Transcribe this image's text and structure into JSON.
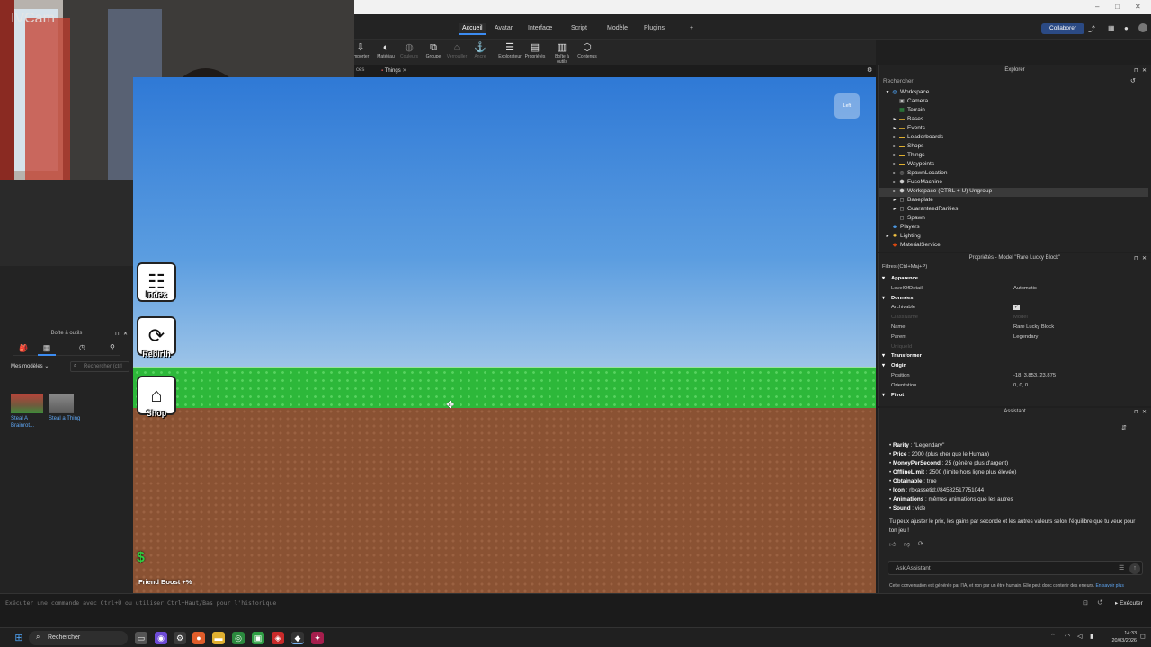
{
  "window": {
    "controls": [
      "–",
      "□",
      "✕"
    ]
  },
  "menu": {
    "tabs": [
      "Accueil",
      "Avatar",
      "Interface",
      "Script",
      "Modèle",
      "Plugins",
      "+"
    ],
    "active_tab": "Accueil",
    "collaborate": "Collaborer"
  },
  "toolbar": {
    "items": [
      {
        "label": "Importer",
        "icon": "import-icon"
      },
      {
        "label": "Matériau",
        "icon": "material-icon"
      },
      {
        "label": "Couleurs",
        "icon": "color-icon",
        "dim": true
      },
      {
        "label": "Groupe",
        "icon": "group-icon"
      },
      {
        "label": "Verrouiller",
        "icon": "lock-icon",
        "dim": true
      },
      {
        "label": "Ancre",
        "icon": "anchor-icon",
        "dim": true
      },
      {
        "label": "Explorateur",
        "icon": "explorer-icon"
      },
      {
        "label": "Propriétés",
        "icon": "properties-icon"
      },
      {
        "label": "Boîte à outils",
        "icon": "toolbox-icon"
      },
      {
        "label": "Contenus",
        "icon": "content-icon"
      }
    ]
  },
  "doc_tabs": {
    "partial": "ces",
    "active": "Things"
  },
  "webcam": {
    "overlay": "IVCam"
  },
  "toolbox": {
    "title": "Boîte à outils",
    "category": "Mes modèles",
    "search_placeholder": "Rechercher (ctrl",
    "items": [
      {
        "label": "Steal A Brainrot..."
      },
      {
        "label": "Steal a Thing"
      }
    ]
  },
  "game_ui": {
    "buttons": [
      {
        "label": "Index",
        "icon": "index-icon"
      },
      {
        "label": "Rebirth",
        "icon": "rebirth-icon"
      },
      {
        "label": "Shop",
        "icon": "shop-icon"
      }
    ],
    "friend_boost": "Friend Boost +%",
    "currency_symbol": "$",
    "corner_label": "Left"
  },
  "explorer": {
    "title": "Explorer",
    "search_placeholder": "Rechercher",
    "items": [
      {
        "label": "Workspace",
        "depth": 0,
        "icon": "workspace-icon",
        "expanded": true
      },
      {
        "label": "Camera",
        "depth": 1,
        "icon": "camera-icon"
      },
      {
        "label": "Terrain",
        "depth": 1,
        "icon": "terrain-icon"
      },
      {
        "label": "Bases",
        "depth": 1,
        "icon": "folder-icon",
        "arrow": true
      },
      {
        "label": "Events",
        "depth": 1,
        "icon": "folder-icon",
        "arrow": true
      },
      {
        "label": "Leaderboards",
        "depth": 1,
        "icon": "folder-icon",
        "arrow": true
      },
      {
        "label": "Shops",
        "depth": 1,
        "icon": "folder-icon",
        "arrow": true
      },
      {
        "label": "Things",
        "depth": 1,
        "icon": "folder-icon",
        "arrow": true
      },
      {
        "label": "Waypoints",
        "depth": 1,
        "icon": "folder-icon",
        "arrow": true
      },
      {
        "label": "SpawnLocation",
        "depth": 1,
        "icon": "spawn-icon",
        "arrow": true
      },
      {
        "label": "FuseMachine",
        "depth": 1,
        "icon": "model-icon",
        "arrow": true
      },
      {
        "label": "Workspace (CTRL + U) Ungroup",
        "depth": 1,
        "icon": "model-icon",
        "arrow": true,
        "selected": true
      },
      {
        "label": "Baseplate",
        "depth": 1,
        "icon": "part-icon",
        "arrow": true
      },
      {
        "label": "GuaranteedRarities",
        "depth": 1,
        "icon": "part-icon",
        "arrow": true
      },
      {
        "label": "Spawn",
        "depth": 1,
        "icon": "part-icon"
      },
      {
        "label": "Players",
        "depth": 0,
        "icon": "players-icon"
      },
      {
        "label": "Lighting",
        "depth": 0,
        "icon": "lighting-icon",
        "arrow": true
      },
      {
        "label": "MaterialService",
        "depth": 0,
        "icon": "material-service-icon"
      }
    ]
  },
  "properties": {
    "title": "Propriétés - Model \"Rare Lucky Block\"",
    "filter": "Filtres (Ctrl+Maj+P)",
    "rows": [
      {
        "section": "Apparence"
      },
      {
        "key": "LevelOfDetail",
        "value": "Automatic"
      },
      {
        "section": "Données"
      },
      {
        "key": "Archivable",
        "value": "✓"
      },
      {
        "key": "ClassName",
        "value": "Model",
        "dim": true
      },
      {
        "key": "Name",
        "value": "Rare Lucky Block"
      },
      {
        "key": "Parent",
        "value": "Legendary"
      },
      {
        "key": "UniqueId",
        "value": "",
        "dim": true
      },
      {
        "section": "Transformer"
      },
      {
        "section": "Origin"
      },
      {
        "key": "Position",
        "value": "-18, 3.853, 23.875"
      },
      {
        "key": "Orientation",
        "value": "0, 0, 0"
      },
      {
        "section": "Pivot"
      }
    ]
  },
  "assistant": {
    "title": "Assistant",
    "bullets": [
      {
        "key": "Rarity",
        "value": " : \"Legendary\""
      },
      {
        "key": "Price",
        "value": " : 2000 (plus cher que le Human)"
      },
      {
        "key": "MoneyPerSecond",
        "value": " : 25 (génère plus d'argent)"
      },
      {
        "key": "OfflineLimit",
        "value": " : 2500 (limite hors ligne plus élevée)"
      },
      {
        "key": "Obtainable",
        "value": " : true"
      },
      {
        "key": "Icon",
        "value": " : rbxassetid://84582517751044"
      },
      {
        "key": "Animations",
        "value": " : mêmes animations que les autres"
      },
      {
        "key": "Sound",
        "value": " : vide"
      }
    ],
    "paragraph_1": "Tu peux ajuster le prix, les gains par seconde et les autres valeurs selon l'équilibre que tu veux pour",
    "paragraph_2": "ton jeu !",
    "input_placeholder": "Ask Assistant",
    "disclaimer": "Cette conversation est générée par l'IA, et non par un être humain. Elle peut donc contenir des erreurs.",
    "learn_more": "En savoir plus"
  },
  "command_bar": {
    "placeholder": "Exécuter une commande avec Ctrl+Ù ou utiliser Ctrl+Haut/Bas pour l'historique",
    "run_label": "Exécuter"
  },
  "taskbar": {
    "search": "Rechercher",
    "time": "14:33",
    "date": "20/03/2026"
  },
  "colors": {
    "accent": "#3c8cf2",
    "grass": "#2db83a",
    "dirt": "#8a5233",
    "panel": "#232323"
  }
}
